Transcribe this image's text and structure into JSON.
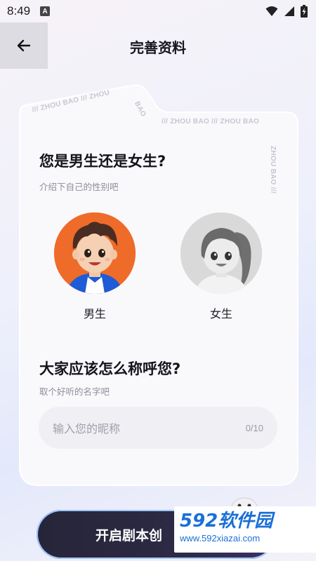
{
  "status_bar": {
    "time": "8:49",
    "notification_icon": "a-notification-icon",
    "icons": [
      "wifi-icon",
      "signal-icon",
      "battery-charging-icon"
    ]
  },
  "header": {
    "back_icon": "arrow-left-icon",
    "title": "完善资料"
  },
  "card": {
    "decorations": [
      "/// ZHOU BAO /// ZHOU",
      "BAO",
      "/// ZHOU BAO /// ZHOU BAO",
      "ZHOU BAO ///"
    ],
    "gender": {
      "title": "您是男生还是女生?",
      "subtitle": "介绍下自己的性别吧",
      "options": [
        {
          "label": "男生",
          "selected": true
        },
        {
          "label": "女生",
          "selected": false
        }
      ]
    },
    "nickname": {
      "title": "大家应该怎么称呼您?",
      "subtitle": "取个好听的名字吧",
      "placeholder": "输入您的昵称",
      "counter": "0/10"
    }
  },
  "start_button": {
    "label": "开启剧本创"
  },
  "watermark": {
    "brand": "592软件园",
    "url": "www.592xiazai.com"
  },
  "colors": {
    "male_avatar_bg": "#ef6b2a",
    "button_bg": "#262538",
    "watermark_blue": "#1b6fd6"
  }
}
